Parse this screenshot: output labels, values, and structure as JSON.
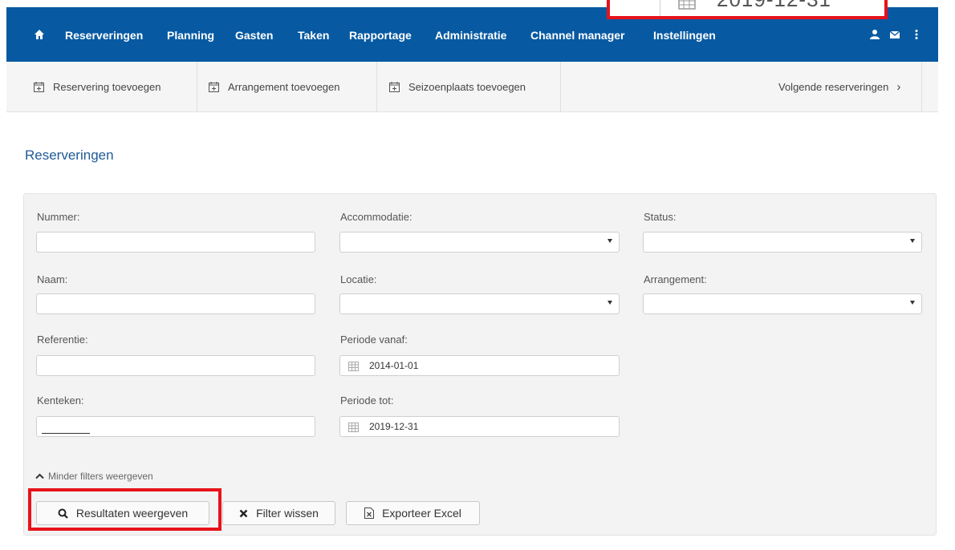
{
  "nav": {
    "home_icon": "home-icon",
    "items": [
      "Reserveringen",
      "Planning",
      "Gasten",
      "Taken",
      "Rapportage",
      "Administratie",
      "Channel manager",
      "Instellingen"
    ],
    "right_icons": [
      "user-icon",
      "envelope-icon",
      "more-vertical-icon"
    ],
    "color": "#075aa2"
  },
  "zoom_overlay": {
    "text": "2019-12-31",
    "highlight_color": "#e8121b"
  },
  "subnav": {
    "items": [
      "Reservering toevoegen",
      "Arrangement toevoegen",
      "Seizoenplaats toevoegen"
    ],
    "next_label": "Volgende reserveringen",
    "next_chevron": "›"
  },
  "page": {
    "title": "Reserveringen"
  },
  "filters": {
    "nummer_label": "Nummer:",
    "accommodatie_label": "Accommodatie:",
    "status_label": "Status:",
    "naam_label": "Naam:",
    "locatie_label": "Locatie:",
    "arrangement_label": "Arrangement:",
    "referentie_label": "Referentie:",
    "periode_vanaf_label": "Periode vanaf:",
    "periode_vanaf_value": "2014-01-01",
    "kenteken_label": "Kenteken:",
    "periode_tot_label": "Periode tot:",
    "periode_tot_value": "2019-12-31",
    "toggle_label": "Minder filters weergeven"
  },
  "buttons": {
    "results": "Resultaten weergeven",
    "clear": "Filter wissen",
    "export": "Exporteer Excel"
  }
}
